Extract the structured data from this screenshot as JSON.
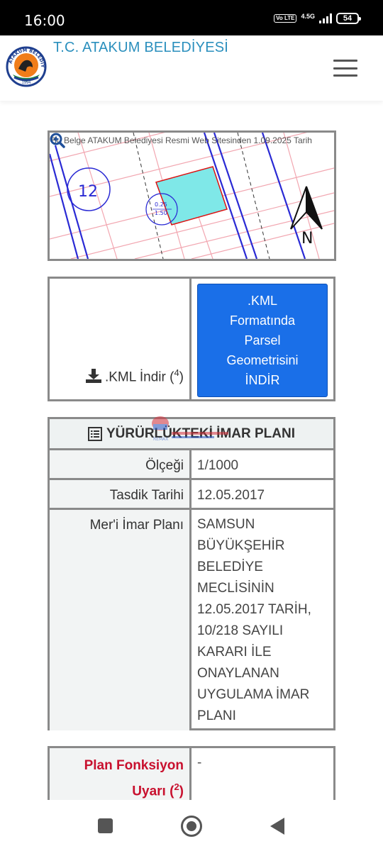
{
  "status_bar": {
    "time": "16:00",
    "volte": "Vo LTE",
    "network": "4.5G",
    "battery": "54"
  },
  "header": {
    "title": "T.C. ATAKUM BELEDİYESİ",
    "logo_text": "ATAKUM BELEDİYESİ",
    "logo_year": "1994",
    "menu_icon": "hamburger-icon"
  },
  "map": {
    "caption": "Bu Belge ATAKUM Belediyesi Resmi Web Sitesinden 1.09.2025 Tarih",
    "block_label": "12",
    "parcel_label_top": "0.25",
    "parcel_label_bottom": "1.50",
    "north_label": "N",
    "zoom_icon": "zoom-in-icon"
  },
  "kml": {
    "download_label": ".KML İndir (",
    "download_sup": "4",
    "download_close": ")",
    "button_lines": [
      ".KML",
      "Formatında",
      "Parsel",
      "Geometrisini",
      "İNDİR"
    ]
  },
  "plan": {
    "heading": "YÜRÜRLÜKTEKİ İMAR PLANI",
    "rows": [
      {
        "key": "Ölçeği",
        "value": "1/1000"
      },
      {
        "key": "Tasdik Tarihi",
        "value": "12.05.2017"
      },
      {
        "key": "Mer'i İmar Planı",
        "value_lines": [
          "SAMSUN",
          "BÜYÜKŞEHİR",
          "BELEDİYE",
          "MECLİSİNİN",
          "12.05.2017 TARİH,",
          "10/218 SAYILI",
          "KARARI İLE",
          "ONAYLANAN",
          "UYGULAMA İMAR",
          "PLANI"
        ]
      }
    ]
  },
  "warning": {
    "key_line1": "Plan Fonksiyon",
    "key_line2": "Uyarı (",
    "key_sup": "2",
    "key_close": ")",
    "value": "-"
  },
  "watermark": "REMAX",
  "colors": {
    "accent": "#2a8fbd",
    "button": "#1a6fe8",
    "warning": "#c8102e",
    "parcel": "#7fe8e8"
  }
}
